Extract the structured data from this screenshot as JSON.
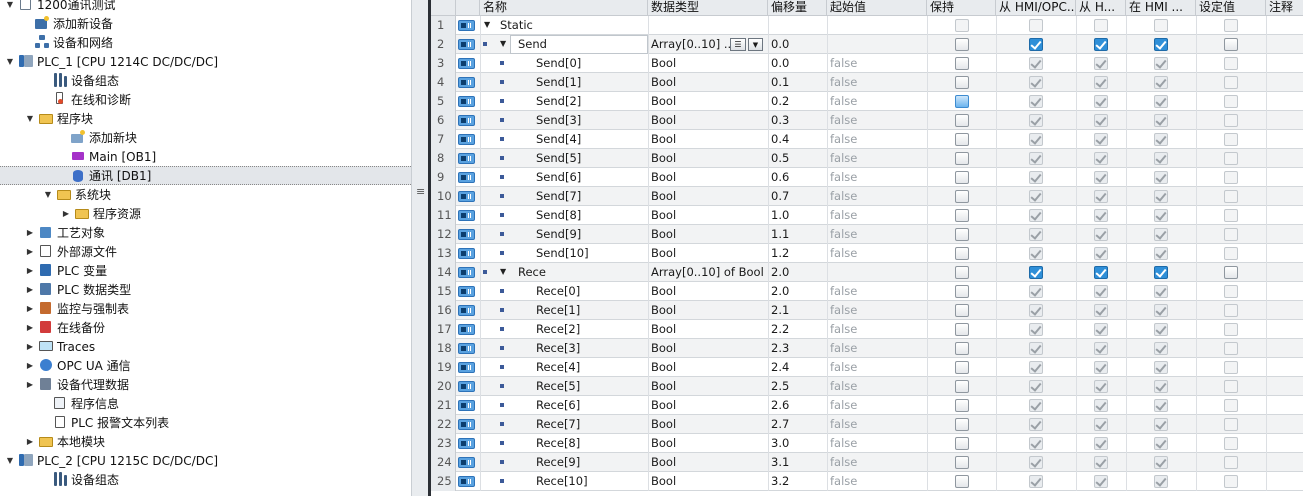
{
  "tree": {
    "items": [
      {
        "label": "1200通讯测试",
        "icon": "project-icon",
        "twisty": "▼"
      },
      {
        "label": "添加新设备",
        "icon": "add-device-icon",
        "twisty": ""
      },
      {
        "label": "设备和网络",
        "icon": "network-icon",
        "twisty": ""
      },
      {
        "label": "PLC_1 [CPU 1214C DC/DC/DC]",
        "icon": "plc-icon",
        "twisty": "▼"
      },
      {
        "label": "设备组态",
        "icon": "device-config-icon",
        "twisty": ""
      },
      {
        "label": "在线和诊断",
        "icon": "online-diagnostics-icon",
        "twisty": ""
      },
      {
        "label": "程序块",
        "icon": "folder-icon",
        "twisty": "▼"
      },
      {
        "label": "添加新块",
        "icon": "add-block-icon",
        "twisty": ""
      },
      {
        "label": "Main [OB1]",
        "icon": "ob-block-icon",
        "twisty": ""
      },
      {
        "label": "通讯 [DB1]",
        "icon": "db-block-icon",
        "twisty": ""
      },
      {
        "label": "系统块",
        "icon": "folder-icon",
        "twisty": "▼"
      },
      {
        "label": "程序资源",
        "icon": "folder-icon",
        "twisty": "▶"
      },
      {
        "label": "工艺对象",
        "icon": "technology-icon",
        "twisty": "▶"
      },
      {
        "label": "外部源文件",
        "icon": "source-file-icon",
        "twisty": "▶"
      },
      {
        "label": "PLC 变量",
        "icon": "tag-table-icon",
        "twisty": "▶"
      },
      {
        "label": "PLC 数据类型",
        "icon": "data-type-icon",
        "twisty": "▶"
      },
      {
        "label": "监控与强制表",
        "icon": "watch-table-icon",
        "twisty": "▶"
      },
      {
        "label": "在线备份",
        "icon": "backup-icon",
        "twisty": "▶"
      },
      {
        "label": "Traces",
        "icon": "trace-icon",
        "twisty": "▶"
      },
      {
        "label": "OPC UA 通信",
        "icon": "opc-ua-icon",
        "twisty": "▶"
      },
      {
        "label": "设备代理数据",
        "icon": "proxy-data-icon",
        "twisty": "▶"
      },
      {
        "label": "程序信息",
        "icon": "program-info-icon",
        "twisty": ""
      },
      {
        "label": "PLC 报警文本列表",
        "icon": "alarm-text-icon",
        "twisty": ""
      },
      {
        "label": "本地模块",
        "icon": "folder-icon",
        "twisty": "▶"
      },
      {
        "label": "PLC_2 [CPU 1215C DC/DC/DC]",
        "icon": "plc-icon",
        "twisty": "▼"
      },
      {
        "label": "设备组态",
        "icon": "device-config-icon",
        "twisty": ""
      }
    ]
  },
  "table": {
    "headers": [
      "名称",
      "数据类型",
      "偏移量",
      "起始值",
      "保持",
      "从 HMI/OPC...",
      "从 H...",
      "在 HMI ...",
      "设定值",
      "注释"
    ],
    "rows": [
      {
        "num": "1",
        "name": "Static",
        "type": "",
        "offset": "",
        "start": "",
        "retain": "dis",
        "hmi1": "dis",
        "hmi2": "dis",
        "hmi3": "dis",
        "setp": "dis"
      },
      {
        "num": "2",
        "name": "Send",
        "type": "Array[0..10] ...",
        "offset": "0.0",
        "start": "",
        "retain": "off",
        "hmi1": "on",
        "hmi2": "on",
        "hmi3": "on",
        "setp": "off"
      },
      {
        "num": "3",
        "name": "Send[0]",
        "type": "Bool",
        "offset": "0.0",
        "start": "false",
        "retain": "off",
        "hmi1": "dison",
        "hmi2": "dison",
        "hmi3": "dison",
        "setp": "dis"
      },
      {
        "num": "4",
        "name": "Send[1]",
        "type": "Bool",
        "offset": "0.1",
        "start": "false",
        "retain": "off",
        "hmi1": "dison",
        "hmi2": "dison",
        "hmi3": "dison",
        "setp": "dis"
      },
      {
        "num": "5",
        "name": "Send[2]",
        "type": "Bool",
        "offset": "0.2",
        "start": "false",
        "retain": "hl",
        "hmi1": "dison",
        "hmi2": "dison",
        "hmi3": "dison",
        "setp": "dis"
      },
      {
        "num": "6",
        "name": "Send[3]",
        "type": "Bool",
        "offset": "0.3",
        "start": "false",
        "retain": "off",
        "hmi1": "dison",
        "hmi2": "dison",
        "hmi3": "dison",
        "setp": "dis"
      },
      {
        "num": "7",
        "name": "Send[4]",
        "type": "Bool",
        "offset": "0.4",
        "start": "false",
        "retain": "off",
        "hmi1": "dison",
        "hmi2": "dison",
        "hmi3": "dison",
        "setp": "dis"
      },
      {
        "num": "8",
        "name": "Send[5]",
        "type": "Bool",
        "offset": "0.5",
        "start": "false",
        "retain": "off",
        "hmi1": "dison",
        "hmi2": "dison",
        "hmi3": "dison",
        "setp": "dis"
      },
      {
        "num": "9",
        "name": "Send[6]",
        "type": "Bool",
        "offset": "0.6",
        "start": "false",
        "retain": "off",
        "hmi1": "dison",
        "hmi2": "dison",
        "hmi3": "dison",
        "setp": "dis"
      },
      {
        "num": "10",
        "name": "Send[7]",
        "type": "Bool",
        "offset": "0.7",
        "start": "false",
        "retain": "off",
        "hmi1": "dison",
        "hmi2": "dison",
        "hmi3": "dison",
        "setp": "dis"
      },
      {
        "num": "11",
        "name": "Send[8]",
        "type": "Bool",
        "offset": "1.0",
        "start": "false",
        "retain": "off",
        "hmi1": "dison",
        "hmi2": "dison",
        "hmi3": "dison",
        "setp": "dis"
      },
      {
        "num": "12",
        "name": "Send[9]",
        "type": "Bool",
        "offset": "1.1",
        "start": "false",
        "retain": "off",
        "hmi1": "dison",
        "hmi2": "dison",
        "hmi3": "dison",
        "setp": "dis"
      },
      {
        "num": "13",
        "name": "Send[10]",
        "type": "Bool",
        "offset": "1.2",
        "start": "false",
        "retain": "off",
        "hmi1": "dison",
        "hmi2": "dison",
        "hmi3": "dison",
        "setp": "dis"
      },
      {
        "num": "14",
        "name": "Rece",
        "type": "Array[0..10] of Bool",
        "offset": "2.0",
        "start": "",
        "retain": "off",
        "hmi1": "on",
        "hmi2": "on",
        "hmi3": "on",
        "setp": "off"
      },
      {
        "num": "15",
        "name": "Rece[0]",
        "type": "Bool",
        "offset": "2.0",
        "start": "false",
        "retain": "off",
        "hmi1": "dison",
        "hmi2": "dison",
        "hmi3": "dison",
        "setp": "dis"
      },
      {
        "num": "16",
        "name": "Rece[1]",
        "type": "Bool",
        "offset": "2.1",
        "start": "false",
        "retain": "off",
        "hmi1": "dison",
        "hmi2": "dison",
        "hmi3": "dison",
        "setp": "dis"
      },
      {
        "num": "17",
        "name": "Rece[2]",
        "type": "Bool",
        "offset": "2.2",
        "start": "false",
        "retain": "off",
        "hmi1": "dison",
        "hmi2": "dison",
        "hmi3": "dison",
        "setp": "dis"
      },
      {
        "num": "18",
        "name": "Rece[3]",
        "type": "Bool",
        "offset": "2.3",
        "start": "false",
        "retain": "off",
        "hmi1": "dison",
        "hmi2": "dison",
        "hmi3": "dison",
        "setp": "dis"
      },
      {
        "num": "19",
        "name": "Rece[4]",
        "type": "Bool",
        "offset": "2.4",
        "start": "false",
        "retain": "off",
        "hmi1": "dison",
        "hmi2": "dison",
        "hmi3": "dison",
        "setp": "dis"
      },
      {
        "num": "20",
        "name": "Rece[5]",
        "type": "Bool",
        "offset": "2.5",
        "start": "false",
        "retain": "off",
        "hmi1": "dison",
        "hmi2": "dison",
        "hmi3": "dison",
        "setp": "dis"
      },
      {
        "num": "21",
        "name": "Rece[6]",
        "type": "Bool",
        "offset": "2.6",
        "start": "false",
        "retain": "off",
        "hmi1": "dison",
        "hmi2": "dison",
        "hmi3": "dison",
        "setp": "dis"
      },
      {
        "num": "22",
        "name": "Rece[7]",
        "type": "Bool",
        "offset": "2.7",
        "start": "false",
        "retain": "off",
        "hmi1": "dison",
        "hmi2": "dison",
        "hmi3": "dison",
        "setp": "dis"
      },
      {
        "num": "23",
        "name": "Rece[8]",
        "type": "Bool",
        "offset": "3.0",
        "start": "false",
        "retain": "off",
        "hmi1": "dison",
        "hmi2": "dison",
        "hmi3": "dison",
        "setp": "dis"
      },
      {
        "num": "24",
        "name": "Rece[9]",
        "type": "Bool",
        "offset": "3.1",
        "start": "false",
        "retain": "off",
        "hmi1": "dison",
        "hmi2": "dison",
        "hmi3": "dison",
        "setp": "dis"
      },
      {
        "num": "25",
        "name": "Rece[10]",
        "type": "Bool",
        "offset": "3.2",
        "start": "false",
        "retain": "off",
        "hmi1": "dison",
        "hmi2": "dison",
        "hmi3": "dison",
        "setp": "dis"
      }
    ]
  },
  "colors": {
    "accent": "#2f8fd8",
    "selected_row": "#e3e6ea",
    "splitter": "#2b2f35"
  }
}
